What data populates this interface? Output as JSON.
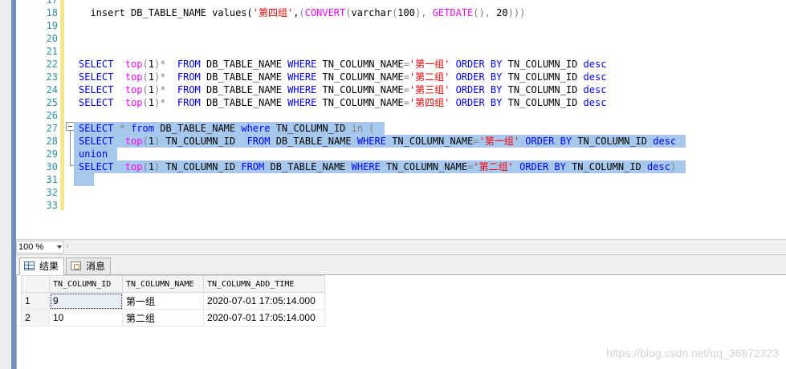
{
  "editor": {
    "line_numbers": [
      "17",
      "18",
      "19",
      "20",
      "21",
      "22",
      "23",
      "24",
      "25",
      "26",
      "27",
      "28",
      "29",
      "30",
      "31",
      "32",
      "33"
    ],
    "lines": [
      {
        "num": "18",
        "parts": [
          [
            "txt",
            "  insert DB_TABLE_NAME values("
          ],
          [
            "str",
            "'第四组'"
          ],
          [
            "txt",
            ","
          ],
          [
            "gray",
            "("
          ],
          [
            "fn",
            "CONVERT"
          ],
          [
            "gray",
            "("
          ],
          [
            "txt",
            "varchar"
          ],
          [
            "gray",
            "("
          ],
          [
            "txt",
            "100"
          ],
          [
            "gray",
            "),"
          ],
          [
            "txt",
            " "
          ],
          [
            "fn",
            "GETDATE"
          ],
          [
            "gray",
            "(),"
          ],
          [
            "txt",
            " 20"
          ],
          [
            "gray",
            ")))"
          ]
        ]
      },
      {
        "num": "22",
        "parts": [
          [
            "kw",
            "SELECT"
          ],
          [
            "txt",
            "  "
          ],
          [
            "fn",
            "top"
          ],
          [
            "gray",
            "("
          ],
          [
            "txt",
            "1"
          ],
          [
            "gray",
            ")*"
          ],
          [
            "txt",
            "  "
          ],
          [
            "kw",
            "FROM"
          ],
          [
            "txt",
            " DB_TABLE_NAME "
          ],
          [
            "kw",
            "WHERE"
          ],
          [
            "txt",
            " TN_COLUMN_NAME"
          ],
          [
            "gray",
            "="
          ],
          [
            "str",
            "'第一组'"
          ],
          [
            "txt",
            " "
          ],
          [
            "kw",
            "ORDER BY"
          ],
          [
            "txt",
            " TN_COLUMN_ID "
          ],
          [
            "kw",
            "desc"
          ]
        ]
      },
      {
        "num": "23",
        "parts": [
          [
            "kw",
            "SELECT"
          ],
          [
            "txt",
            "  "
          ],
          [
            "fn",
            "top"
          ],
          [
            "gray",
            "("
          ],
          [
            "txt",
            "1"
          ],
          [
            "gray",
            ")*"
          ],
          [
            "txt",
            "  "
          ],
          [
            "kw",
            "FROM"
          ],
          [
            "txt",
            " DB_TABLE_NAME "
          ],
          [
            "kw",
            "WHERE"
          ],
          [
            "txt",
            " TN_COLUMN_NAME"
          ],
          [
            "gray",
            "="
          ],
          [
            "str",
            "'第二组'"
          ],
          [
            "txt",
            " "
          ],
          [
            "kw",
            "ORDER BY"
          ],
          [
            "txt",
            " TN_COLUMN_ID "
          ],
          [
            "kw",
            "desc"
          ]
        ]
      },
      {
        "num": "24",
        "parts": [
          [
            "kw",
            "SELECT"
          ],
          [
            "txt",
            "  "
          ],
          [
            "fn",
            "top"
          ],
          [
            "gray",
            "("
          ],
          [
            "txt",
            "1"
          ],
          [
            "gray",
            ")*"
          ],
          [
            "txt",
            "  "
          ],
          [
            "kw",
            "FROM"
          ],
          [
            "txt",
            " DB_TABLE_NAME "
          ],
          [
            "kw",
            "WHERE"
          ],
          [
            "txt",
            " TN_COLUMN_NAME"
          ],
          [
            "gray",
            "="
          ],
          [
            "str",
            "'第三组'"
          ],
          [
            "txt",
            " "
          ],
          [
            "kw",
            "ORDER BY"
          ],
          [
            "txt",
            " TN_COLUMN_ID "
          ],
          [
            "kw",
            "desc"
          ]
        ]
      },
      {
        "num": "25",
        "parts": [
          [
            "kw",
            "SELECT"
          ],
          [
            "txt",
            "  "
          ],
          [
            "fn",
            "top"
          ],
          [
            "gray",
            "("
          ],
          [
            "txt",
            "1"
          ],
          [
            "gray",
            ")*"
          ],
          [
            "txt",
            "  "
          ],
          [
            "kw",
            "FROM"
          ],
          [
            "txt",
            " DB_TABLE_NAME "
          ],
          [
            "kw",
            "WHERE"
          ],
          [
            "txt",
            " TN_COLUMN_NAME"
          ],
          [
            "gray",
            "="
          ],
          [
            "str",
            "'第四组'"
          ],
          [
            "txt",
            " "
          ],
          [
            "kw",
            "ORDER BY"
          ],
          [
            "txt",
            " TN_COLUMN_ID "
          ],
          [
            "kw",
            "desc"
          ]
        ]
      },
      {
        "num": "27",
        "sel": true,
        "parts": [
          [
            "kw",
            "SELECT"
          ],
          [
            "txt",
            " "
          ],
          [
            "gray",
            "*"
          ],
          [
            "txt",
            " "
          ],
          [
            "kw",
            "from"
          ],
          [
            "txt",
            " DB_TABLE_NAME "
          ],
          [
            "kw",
            "where"
          ],
          [
            "txt",
            " TN_COLUMN_ID "
          ],
          [
            "gray",
            "in ("
          ]
        ]
      },
      {
        "num": "28",
        "sel": true,
        "parts": [
          [
            "kw",
            "SELECT"
          ],
          [
            "txt",
            "  "
          ],
          [
            "fn",
            "top"
          ],
          [
            "gray",
            "("
          ],
          [
            "txt",
            "1"
          ],
          [
            "gray",
            ")"
          ],
          [
            "txt",
            " TN_COLUMN_ID  "
          ],
          [
            "kw",
            "FROM"
          ],
          [
            "txt",
            " DB_TABLE_NAME "
          ],
          [
            "kw",
            "WHERE"
          ],
          [
            "txt",
            " TN_COLUMN_NAME"
          ],
          [
            "gray",
            "="
          ],
          [
            "str",
            "'第一组'"
          ],
          [
            "txt",
            " "
          ],
          [
            "kw",
            "ORDER BY"
          ],
          [
            "txt",
            " TN_COLUMN_ID "
          ],
          [
            "kw",
            "desc"
          ]
        ]
      },
      {
        "num": "29",
        "sel": true,
        "parts": [
          [
            "kw",
            "union"
          ]
        ]
      },
      {
        "num": "30",
        "sel": true,
        "parts": [
          [
            "kw",
            "SELECT"
          ],
          [
            "txt",
            "  "
          ],
          [
            "fn",
            "top"
          ],
          [
            "gray",
            "("
          ],
          [
            "txt",
            "1"
          ],
          [
            "gray",
            ")"
          ],
          [
            "txt",
            " TN_COLUMN_ID "
          ],
          [
            "kw",
            "FROM"
          ],
          [
            "txt",
            " DB_TABLE_NAME "
          ],
          [
            "kw",
            "WHERE"
          ],
          [
            "txt",
            " TN_COLUMN_NAME"
          ],
          [
            "gray",
            "="
          ],
          [
            "str",
            "'第二组'"
          ],
          [
            "txt",
            " "
          ],
          [
            "kw",
            "ORDER BY"
          ],
          [
            "txt",
            " TN_COLUMN_ID "
          ],
          [
            "kw",
            "desc"
          ],
          [
            "gray",
            ")"
          ]
        ]
      },
      {
        "num": "31",
        "sel": true,
        "parts": [
          [
            "txt",
            " "
          ]
        ]
      }
    ]
  },
  "zoom": {
    "value": "100 %",
    "scroll_glyph": "‹"
  },
  "tabs": [
    {
      "label": "结果",
      "icon": "grid-icon",
      "active": true
    },
    {
      "label": "消息",
      "icon": "message-icon",
      "active": false
    }
  ],
  "results": {
    "columns": [
      "TN_COLUMN_ID",
      "TN_COLUMN_NAME",
      "TN_COLUMN_ADD_TIME"
    ],
    "rows": [
      {
        "n": "1",
        "cells": [
          "9",
          "第一组",
          "2020-07-01 17:05:14.000"
        ]
      },
      {
        "n": "2",
        "cells": [
          "10",
          "第二组",
          "2020-07-01 17:05:14.000"
        ]
      }
    ]
  },
  "watermark": "https://blog.csdn.net/qq_36872323",
  "colors": {
    "keyword": "#0000ff",
    "function": "#ff00ff",
    "string": "#ff0000",
    "selection": "#a6c8ec",
    "line_number": "#2b91af"
  }
}
